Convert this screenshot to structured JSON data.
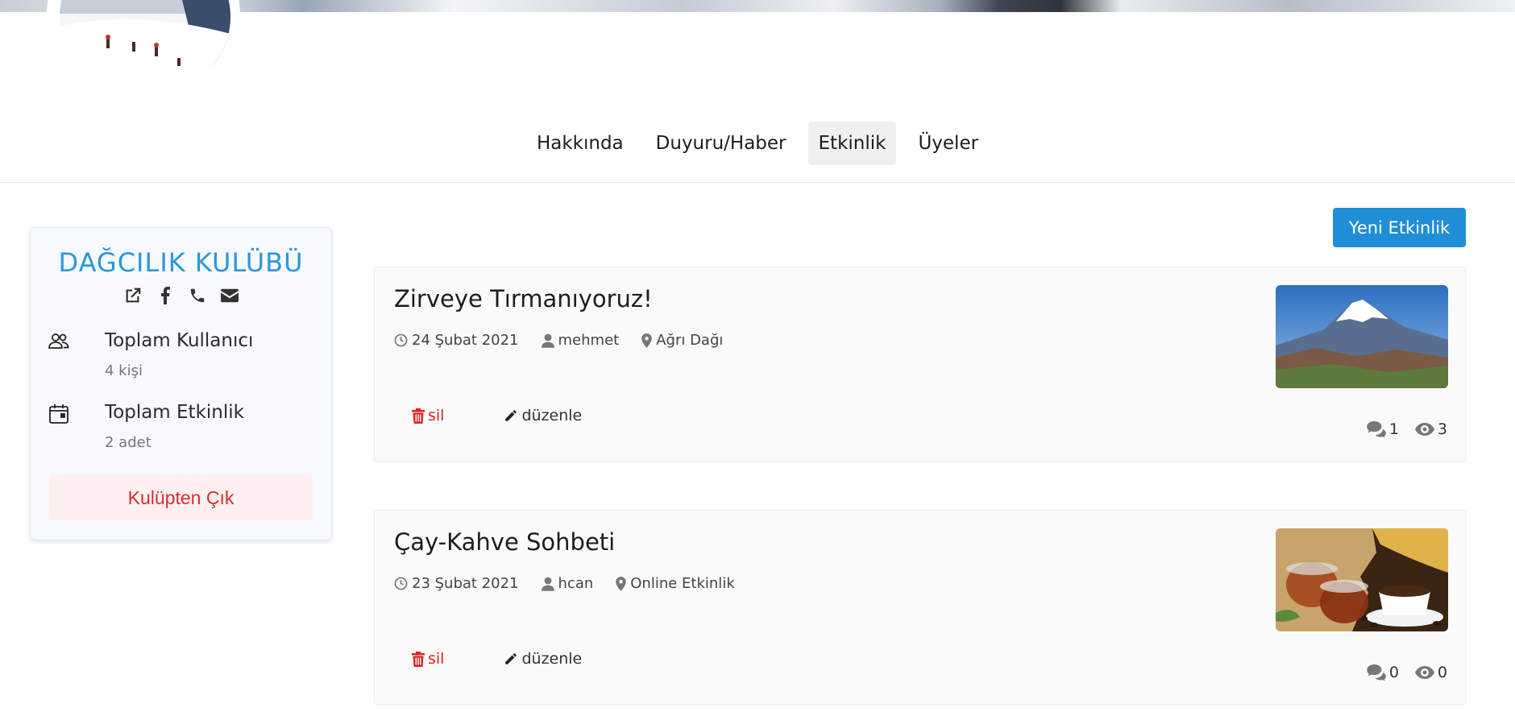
{
  "tabs": [
    {
      "label": "Hakkında"
    },
    {
      "label": "Duyuru/Haber"
    },
    {
      "label": "Etkinlik",
      "active": true
    },
    {
      "label": "Üyeler"
    }
  ],
  "club": {
    "name": "DAĞCILIK KULÜBÜ",
    "icons": [
      "external-link-icon",
      "facebook-icon",
      "phone-icon",
      "envelope-icon"
    ],
    "stats": [
      {
        "icon": "users-icon",
        "title": "Toplam Kullanıcı",
        "value": "4 kişi"
      },
      {
        "icon": "calendar-icon",
        "title": "Toplam Etkinlik",
        "value": "2 adet"
      }
    ],
    "leave_label": "Kulüpten Çık"
  },
  "new_event_label": "Yeni Etkinlik",
  "events": [
    {
      "title": "Zirveye Tırmanıyoruz!",
      "date": "24 Şubat 2021",
      "author": "mehmet",
      "location": "Ağrı Dağı",
      "delete_label": "sil",
      "edit_label": "düzenle",
      "comments": "1",
      "views": "3",
      "thumbnail": "mountain-photo"
    },
    {
      "title": "Çay-Kahve Sohbeti",
      "date": "23 Şubat 2021",
      "author": "hcan",
      "location": "Online Etkinlik",
      "delete_label": "sil",
      "edit_label": "düzenle",
      "comments": "0",
      "views": "0",
      "thumbnail": "tea-coffee-photo"
    }
  ],
  "colors": {
    "accent": "#2b97d9",
    "button": "#1f8ed6",
    "danger": "#e02020",
    "leave_bg": "#ffeff0"
  }
}
